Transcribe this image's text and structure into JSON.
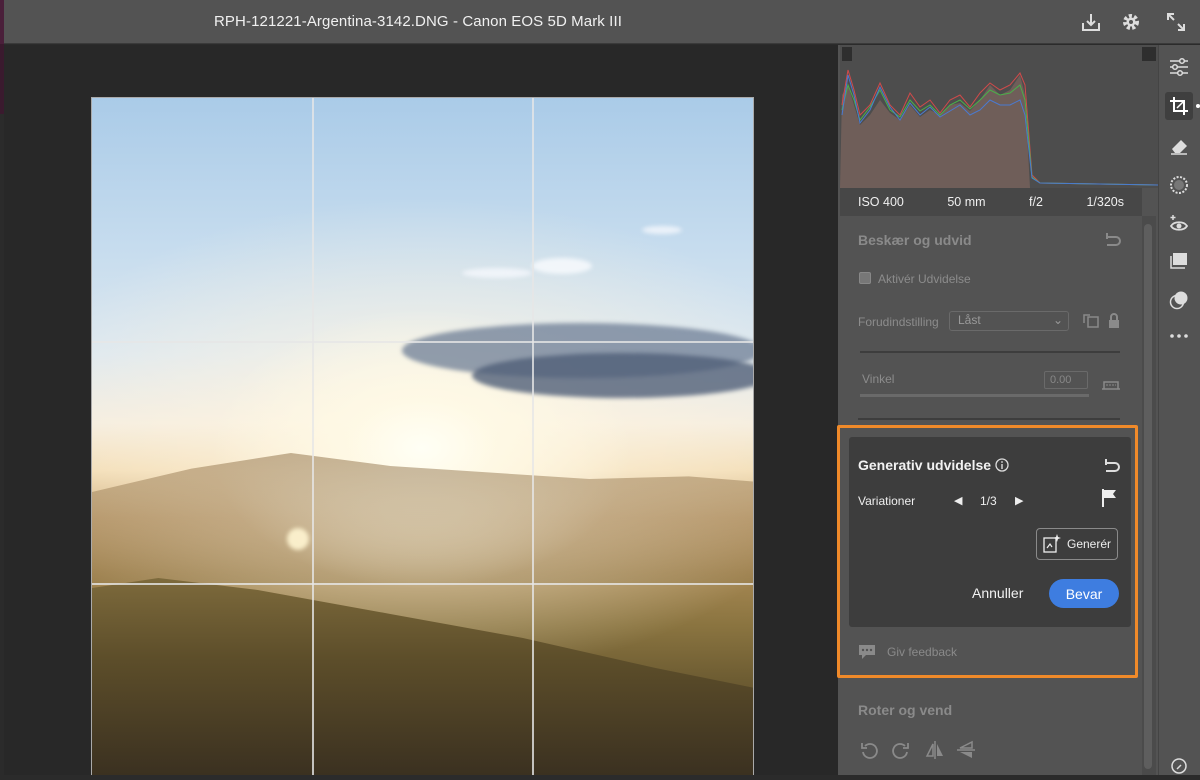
{
  "window": {
    "title": "RPH-121221-Argentina-3142.DNG  -  Canon EOS 5D Mark III"
  },
  "titlebar_icons": [
    "download-icon",
    "gear-icon",
    "expand-icon"
  ],
  "camera_info": {
    "iso": "ISO 400",
    "focal": "50 mm",
    "aperture": "f/2",
    "shutter": "1/320s"
  },
  "crop_section": {
    "title": "Beskær og udvid",
    "enable_expand_label": "Aktivér Udvidelse",
    "preset_label": "Forudindstilling",
    "preset_value": "Låst",
    "angle_label": "Vinkel",
    "angle_value": "0.00"
  },
  "generative_expand": {
    "title": "Generativ udvidelse",
    "variations_label": "Variationer",
    "variation_counter": "1/3",
    "generate_label": "Generér",
    "cancel_label": "Annuller",
    "save_label": "Bevar",
    "feedback_label": "Giv feedback"
  },
  "rotate_section": {
    "title": "Roter og vend"
  },
  "toolstrip_icons": [
    "edit-sliders-icon",
    "crop-icon",
    "eraser-icon",
    "mask-icon",
    "redeye-icon",
    "presets-icon",
    "layers-icon",
    "more-icon",
    "help-icon"
  ],
  "colors": {
    "accent_blue": "#3e7de0",
    "highlight_orange": "#f08a2a",
    "panel_bg": "#535353",
    "card_bg": "#3d3d3d"
  }
}
